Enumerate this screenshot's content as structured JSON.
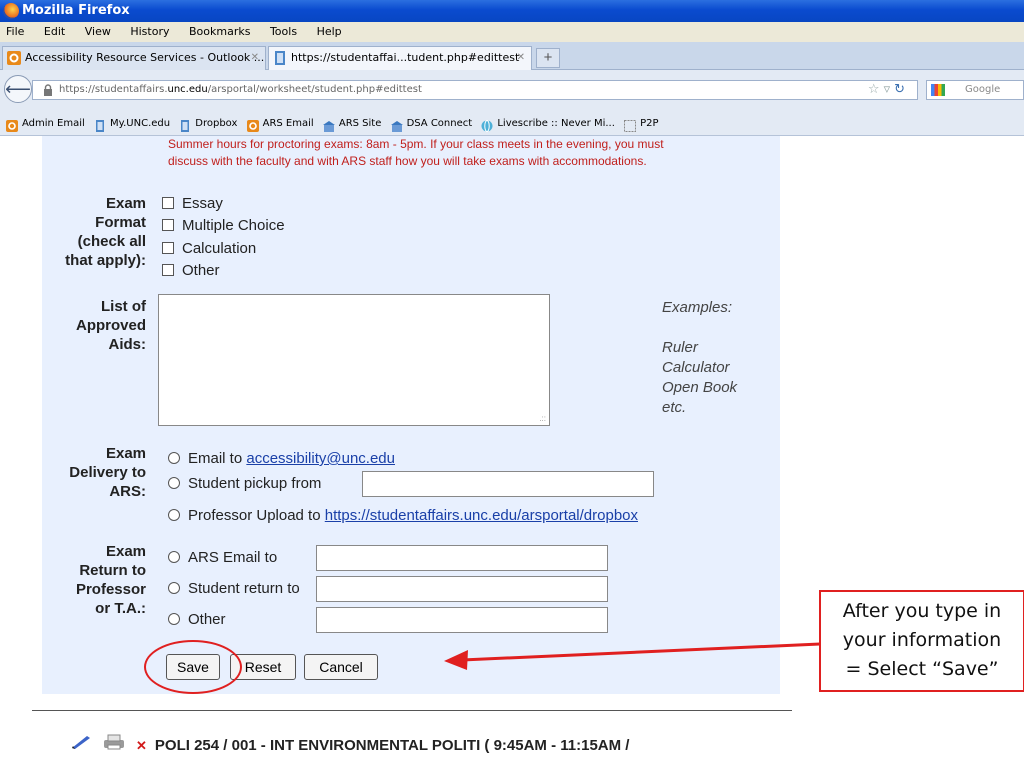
{
  "window": {
    "title": "Mozilla Firefox"
  },
  "menu": [
    "File",
    "Edit",
    "View",
    "History",
    "Bookmarks",
    "Tools",
    "Help"
  ],
  "tabs": [
    {
      "label": "Accessibility Resource Services - Outlook ...",
      "active": false
    },
    {
      "label": "https://studentaffai...tudent.php#edittest",
      "active": true
    }
  ],
  "url": {
    "prefix": "https://studentaffairs.",
    "host": "unc.edu",
    "path": "/arsportal/worksheet/student.php#edittest"
  },
  "search": {
    "placeholder": "Google"
  },
  "bookmarks": [
    "Admin Email",
    "My.UNC.edu",
    "Dropbox",
    "ARS Email",
    "ARS Site",
    "DSA Connect",
    "Livescribe :: Never Mi...",
    "P2P"
  ],
  "form": {
    "note_line1": "Summer hours for proctoring exams: 8am - 5pm. If your class meets in the evening, you must",
    "note_line2": "discuss with the faculty and with ARS staff how you will take exams with accommodations.",
    "exam_format": {
      "label_lines": [
        "Exam",
        "Format",
        "(check all",
        "that apply):"
      ],
      "options": [
        "Essay",
        "Multiple Choice",
        "Calculation",
        "Other"
      ]
    },
    "aids": {
      "label_lines": [
        "List of",
        "Approved",
        "Aids:"
      ],
      "examples_title": "Examples:",
      "examples": [
        "Ruler",
        "Calculator",
        "Open Book",
        "etc."
      ]
    },
    "delivery": {
      "label_lines": [
        "Exam",
        "Delivery to",
        "ARS:"
      ],
      "email_prefix": "Email to ",
      "email_link": "accessibility@unc.edu",
      "pickup": "Student pickup from",
      "upload_prefix": "Professor Upload to ",
      "upload_link": "https://studentaffairs.unc.edu/arsportal/dropbox"
    },
    "return": {
      "label_lines": [
        "Exam",
        "Return to",
        "Professor",
        "or T.A.:"
      ],
      "options": [
        "ARS Email to",
        "Student return to",
        "Other"
      ]
    },
    "buttons": {
      "save": "Save",
      "reset": "Reset",
      "cancel": "Cancel"
    }
  },
  "course": {
    "text": "POLI 254 / 001 - INT ENVIRONMENTAL POLITI ( 9:45AM - 11:15AM /"
  },
  "annotation": {
    "lines": [
      "After you type in",
      "your information",
      "= Select “Save”"
    ],
    "color": "#e02020"
  }
}
